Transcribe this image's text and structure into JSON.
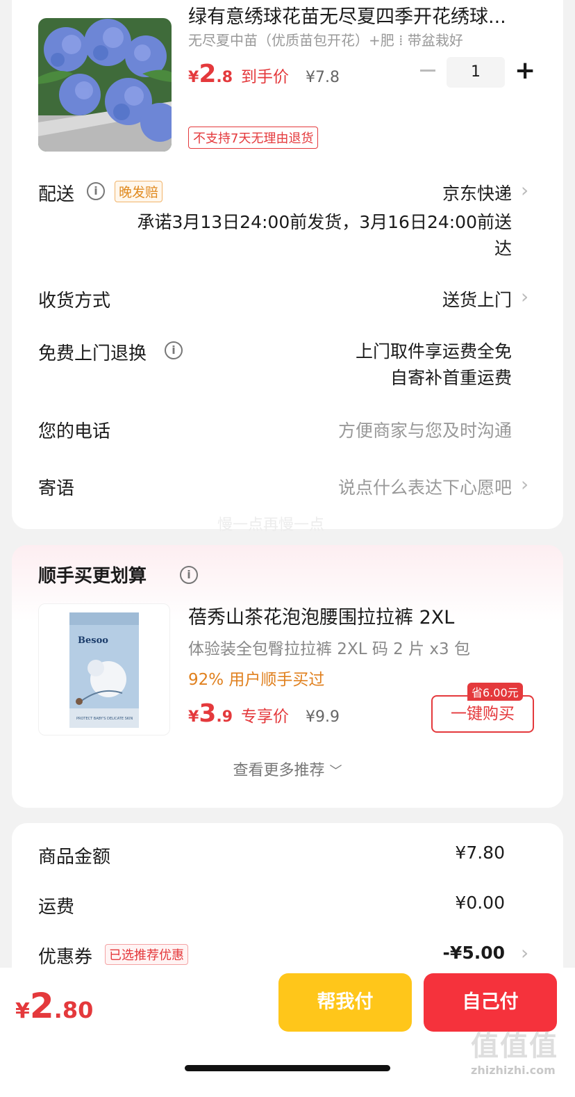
{
  "product": {
    "title": "绿有意绣球花苗无尽夏四季开花绣球...",
    "spec": "无尽夏中苗（优质苗包开花）+肥 ⁞ 带盆栽好",
    "price_symbol": "¥",
    "price_int": "2",
    "price_dec": ".8",
    "price_tag": "到手价",
    "original_price": "¥7.8",
    "quantity": "1",
    "no_return_label": "不支持7天无理由退货"
  },
  "delivery": {
    "label": "配送",
    "badge": "晚发赔",
    "carrier": "京东快递",
    "promise_line1": "承诺3月13日24:00前发货，3月16日24:00前送",
    "promise_line2": "达"
  },
  "receive": {
    "label": "收货方式",
    "value": "送货上门"
  },
  "free_return": {
    "label": "免费上门退换",
    "line1": "上门取件享运费全免",
    "line2": "自寄补首重运费"
  },
  "phone": {
    "label": "您的电话",
    "placeholder": "方便商家与您及时沟通"
  },
  "message": {
    "label": "寄语",
    "placeholder": "说点什么表达下心愿吧"
  },
  "watermark": "慢一点再慢一点",
  "recommend": {
    "title": "顺手买更划算",
    "item_name": "蓓秀山茶花泡泡腰围拉拉裤 2XL",
    "item_spec": "体验装全包臀拉拉裤 2XL 码 2 片 x3 包",
    "popularity": "92% 用户顺手买过",
    "price_symbol": "¥",
    "price_int": "3",
    "price_dec": ".9",
    "price_tag": "专享价",
    "original_price": "¥9.9",
    "save_tag": "省6.00元",
    "buy_label": "一键购买",
    "more_label": "查看更多推荐",
    "brand_text": "Besoo",
    "package_caption": "PROTECT BABY'S DELICATE SKIN"
  },
  "summary": {
    "goods_label": "商品金额",
    "goods_value": "¥7.80",
    "shipping_label": "运费",
    "shipping_value": "¥0.00",
    "coupon_label": "优惠券",
    "coupon_badge": "已选推荐优惠",
    "coupon_value": "-¥5.00"
  },
  "bottom": {
    "total_symbol": "¥",
    "total_int": "2",
    "total_dec": ".80",
    "help_pay_label": "帮我付",
    "self_pay_label": "自己付",
    "help_pay_color": "#ffc61a",
    "self_pay_color": "#f5323c"
  },
  "site_logo": "值值值",
  "site_url": "zhizhizhi.com",
  "colors": {
    "accent_red": "#e4393c",
    "orange": "#e0801e",
    "background": "#f2f2f2"
  }
}
